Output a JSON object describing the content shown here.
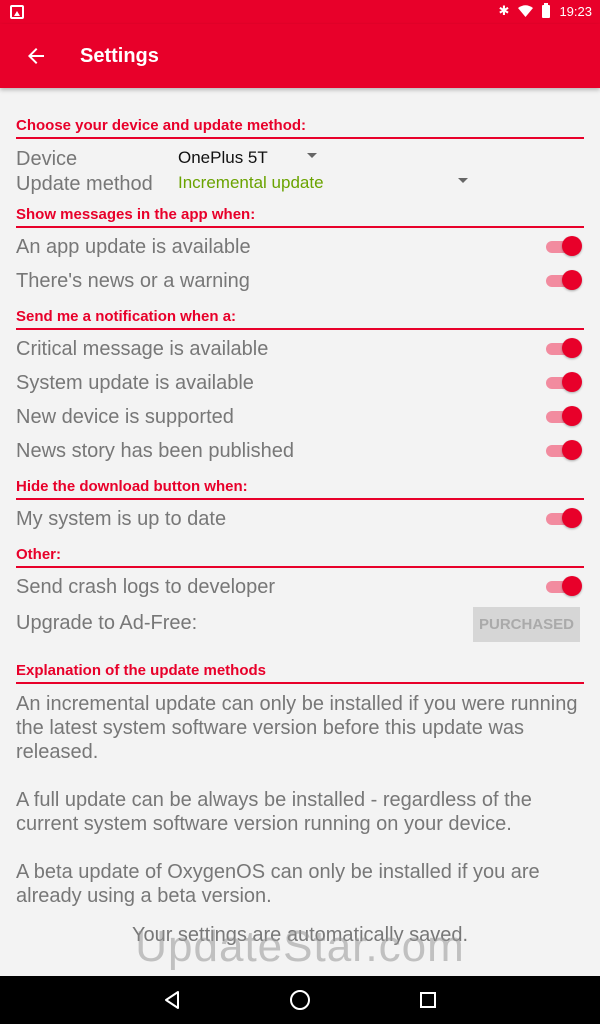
{
  "status_bar": {
    "time": "19:23",
    "icons": [
      "image-icon",
      "bluetooth-icon",
      "wifi-icon",
      "battery-icon"
    ]
  },
  "app_bar": {
    "title": "Settings",
    "back_icon": "arrow-left-icon"
  },
  "device_section": {
    "header": "Choose your device and update method:",
    "device_label": "Device",
    "device_value": "OnePlus 5T",
    "method_label": "Update method",
    "method_value": "Incremental update"
  },
  "messages_section": {
    "header": "Show messages in the app when:",
    "items": [
      {
        "label": "An app update is available",
        "checked": true
      },
      {
        "label": "There's news or a warning",
        "checked": true
      }
    ]
  },
  "notification_section": {
    "header": "Send me a notification when a:",
    "items": [
      {
        "label": "Critical message is available",
        "checked": true
      },
      {
        "label": "System update is available",
        "checked": true
      },
      {
        "label": "New device is supported",
        "checked": true
      },
      {
        "label": "News story has been published",
        "checked": true
      }
    ]
  },
  "download_section": {
    "header": "Hide the download button when:",
    "items": [
      {
        "label": "My system is up to date",
        "checked": true
      }
    ]
  },
  "other_section": {
    "header": "Other:",
    "crash_logs_label": "Send crash logs to developer",
    "crash_logs_checked": true,
    "adfree_label": "Upgrade to Ad-Free:",
    "adfree_button": "PURCHASED"
  },
  "explanation_section": {
    "header": "Explanation of the update methods",
    "paragraphs": [
      "An incremental update can only be installed if you were running the latest system software version before this update was released.",
      "A full update can be always be installed - regardless of the current system software version running on your device.",
      "A beta update of OxygenOS can only be installed if you are already using a beta version."
    ]
  },
  "footer": {
    "saved_text": "Your settings are automatically saved.",
    "watermark": "UpdateStar.com"
  },
  "colors": {
    "accent": "#e8002a",
    "value_green": "#6aa300",
    "text_gray": "#777777",
    "background": "#f3f3f3"
  }
}
